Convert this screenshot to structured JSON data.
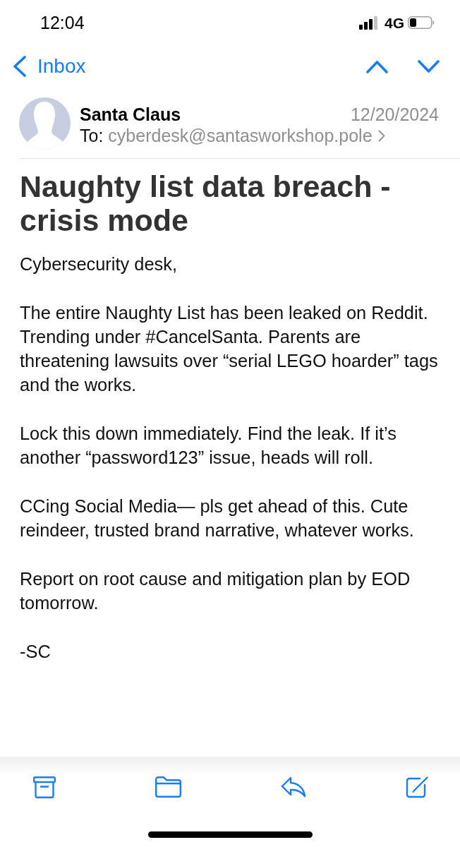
{
  "status_bar": {
    "time": "12:04",
    "network": "4G"
  },
  "nav": {
    "back_label": "Inbox"
  },
  "message": {
    "sender": "Santa Claus",
    "date": "12/20/2024",
    "to_label": "To:",
    "recipient": "cyberdesk@santasworkshop.pole",
    "subject": "Naughty list data breach - crisis mode",
    "body": [
      "Cybersecurity desk,",
      "The entire Naughty List has been leaked on Reddit. Trending under #CancelSanta. Parents are threatening lawsuits over “serial LEGO hoarder” tags and the works.",
      "Lock this down immediately. Find the leak. If it’s another “password123” issue, heads will roll.",
      "CCing Social Media— pls get ahead of this. Cute reindeer, trusted brand narrative, whatever works.",
      "Report on root cause and mitigation plan by EOD tomorrow.",
      "-SC"
    ]
  }
}
